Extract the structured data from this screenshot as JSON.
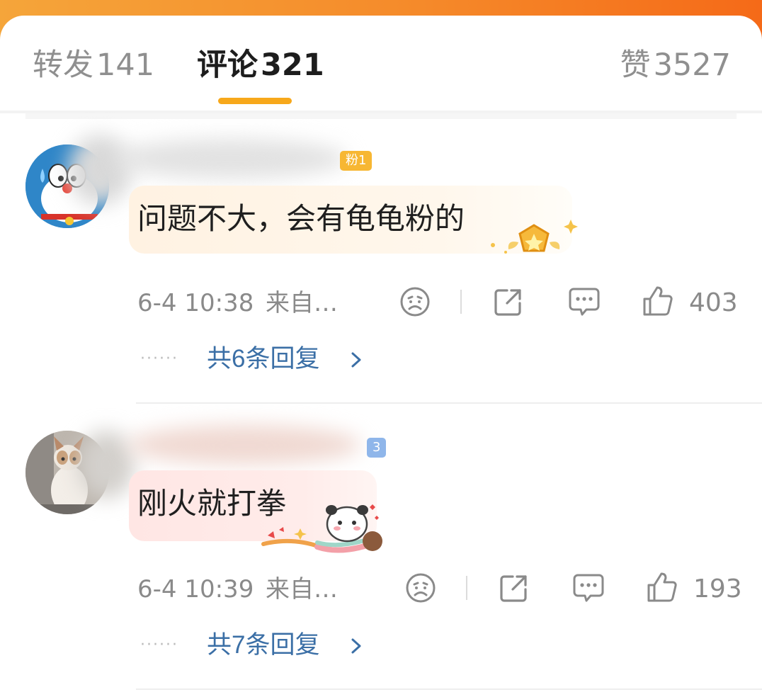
{
  "tabs": {
    "repost": {
      "label": "转发",
      "count": "141"
    },
    "comments": {
      "label": "评论",
      "count": "321"
    },
    "likes": {
      "label": "赞",
      "count": "3527"
    }
  },
  "comments": [
    {
      "badge": "粉1",
      "text": "问题不大，会有龟龟粉的",
      "timestamp": "6-4 10:38",
      "source": "来自…",
      "like_count": "403",
      "replies": "共6条回复",
      "avatar_icon": "doraemon-avatar",
      "sticker_icon": "gold-star-badge-icon"
    },
    {
      "badge": "3",
      "text": "刚火就打拳",
      "timestamp": "6-4 10:39",
      "source": "来自…",
      "like_count": "193",
      "replies": "共7条回复",
      "avatar_icon": "cat-avatar",
      "sticker_icon": "panda-sticker-icon"
    }
  ],
  "colors": {
    "accent": "#f7a81b",
    "link": "#3b6fa6",
    "topbar": "#f58a2a"
  }
}
